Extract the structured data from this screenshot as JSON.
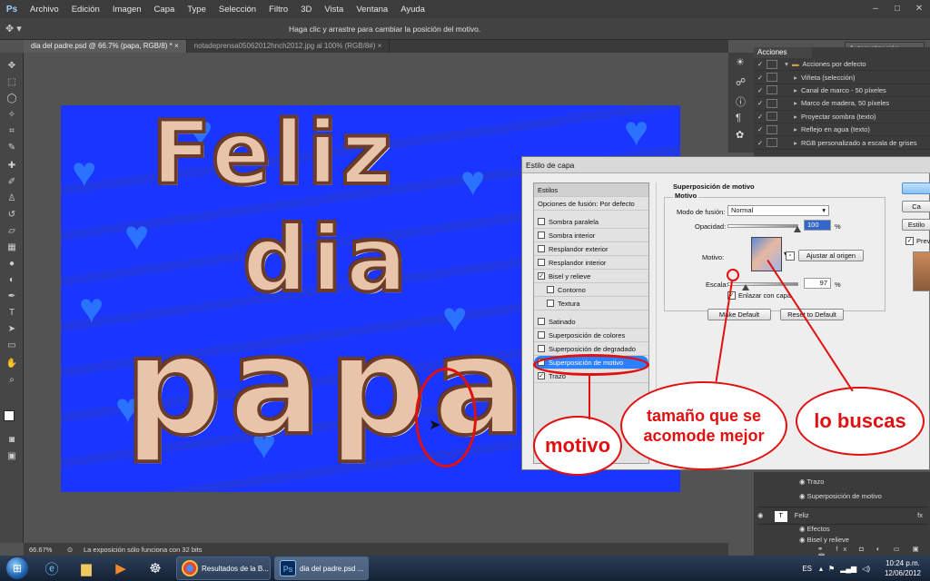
{
  "app": {
    "logo": "Ps"
  },
  "menubar": {
    "items": [
      "Archivo",
      "Edición",
      "Imagen",
      "Capa",
      "Type",
      "Selección",
      "Filtro",
      "3D",
      "Vista",
      "Ventana",
      "Ayuda"
    ]
  },
  "window_controls": {
    "minimize": "–",
    "maximize": "□",
    "close": "✕"
  },
  "options_bar": {
    "hint": "Haga clic y arrastre para cambiar la posición del motivo.",
    "workspace": "Automatización"
  },
  "tabs": [
    {
      "label": "dia del padre.psd @ 66.7% (papa, RGB/8) *",
      "active": true,
      "close": "×"
    },
    {
      "label": "notadeprensa05062012hnch2012.jpg al 100% (RGB/8#)",
      "active": false,
      "close": "×"
    }
  ],
  "canvas": {
    "background_color": "#1a35ff",
    "words": [
      "Feliz",
      "dia",
      "papa"
    ]
  },
  "status_bar": {
    "zoom": "66.67%",
    "message": "La exposición sólo funciona con 32 bits"
  },
  "actions_panel": {
    "title": "Acciones",
    "items": [
      "Acciones por defecto",
      "Viñeta (selección)",
      "Canal de marco - 50 píxeles",
      "Marco de madera, 50 píxeles",
      "Proyectar sombra (texto)",
      "Reflejo en agua (texto)",
      "RGB personalizado a escala de grises"
    ]
  },
  "layers_panel": {
    "items": [
      "Trazo",
      "Superposición de motivo",
      "Feliz",
      "Efectos",
      "Bisel y relieve"
    ],
    "fx": "fx"
  },
  "dialog": {
    "title": "Estilo de capa",
    "list": [
      {
        "label": "Estilos",
        "checkbox": false
      },
      {
        "label": "Opciones de fusión: Por defecto",
        "checkbox": false
      },
      {
        "label": "Sombra paralela",
        "checkbox": true,
        "checked": false
      },
      {
        "label": "Sombra interior",
        "checkbox": true,
        "checked": false
      },
      {
        "label": "Resplandor exterior",
        "checkbox": true,
        "checked": false
      },
      {
        "label": "Resplandor interior",
        "checkbox": true,
        "checked": false
      },
      {
        "label": "Bisel y relieve",
        "checkbox": true,
        "checked": true
      },
      {
        "label": "Contorno",
        "checkbox": true,
        "checked": false
      },
      {
        "label": "Textura",
        "checkbox": true,
        "checked": false
      },
      {
        "label": "Satinado",
        "checkbox": true,
        "checked": false
      },
      {
        "label": "Superposición de colores",
        "checkbox": true,
        "checked": false
      },
      {
        "label": "Superposición de degradado",
        "checkbox": true,
        "checked": false
      },
      {
        "label": "Superposición de motivo",
        "checkbox": true,
        "checked": true,
        "selected": true
      },
      {
        "label": "Trazo",
        "checkbox": true,
        "checked": true
      }
    ],
    "section_title": "Superposición de motivo",
    "group_title": "Motivo",
    "blend_label": "Modo de fusión:",
    "blend_value": "Normal",
    "opacity_label": "Opacidad:",
    "opacity_value": "100",
    "opacity_unit": "%",
    "pattern_label": "Motivo:",
    "snap_button": "Ajustar al origen",
    "scale_label": "Escala:",
    "scale_value": "97",
    "scale_unit": "%",
    "link_label": "Enlazar con capa",
    "make_default": "Make Default",
    "reset_default": "Reset to Default",
    "side_buttons": [
      "",
      "Ca",
      "Estilo"
    ],
    "preview_label": "Prev"
  },
  "annotations": {
    "motivo": "motivo",
    "tamano": "tamaño que se acomode mejor",
    "buscas": "lo buscas",
    "color": "#e01010"
  },
  "taskbar": {
    "tasks": [
      {
        "label": "Resultados de la B...",
        "icon": "chrome-icon"
      },
      {
        "label": "dia del padre.psd ...",
        "icon": "ps-icon",
        "icon_text": "Ps"
      }
    ],
    "language": "ES",
    "time": "10:24 p.m.",
    "date": "12/06/2012"
  }
}
